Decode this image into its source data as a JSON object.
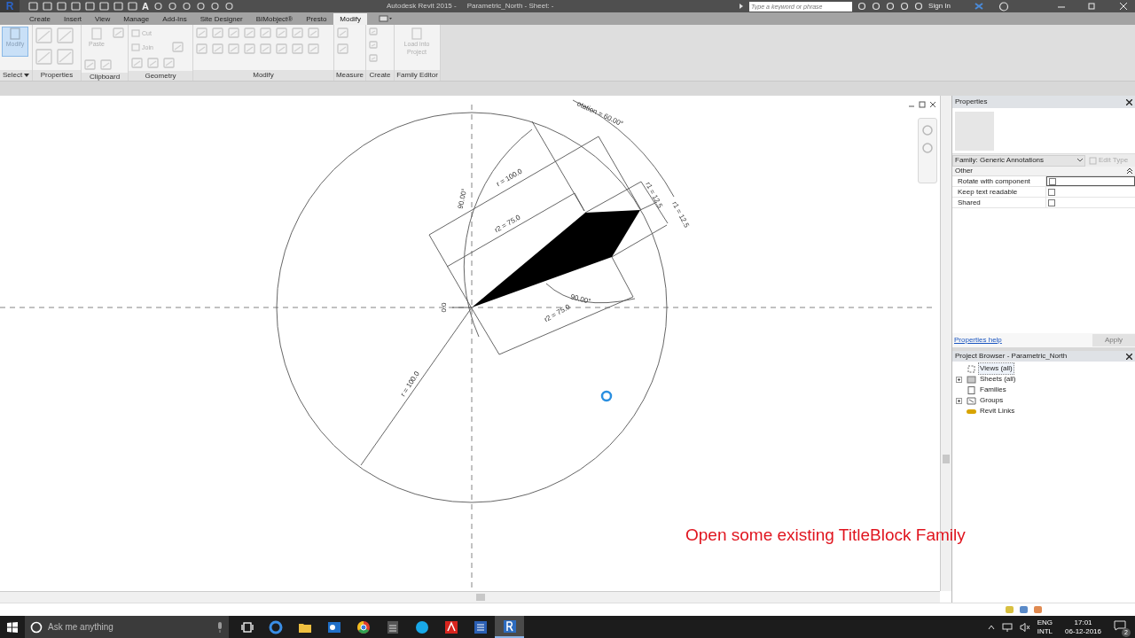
{
  "title_bar": {
    "logo": "R",
    "text_tool": "A",
    "app_title": "Autodesk Revit 2015 -",
    "document": "Parametric_North - Sheet: -",
    "search": {
      "placeholder": "Type a keyword or phrase"
    },
    "sign_in": "Sign In"
  },
  "tabs": [
    {
      "label": "Create",
      "selected": false
    },
    {
      "label": "Insert",
      "selected": false
    },
    {
      "label": "View",
      "selected": false
    },
    {
      "label": "Manage",
      "selected": false
    },
    {
      "label": "Add-Ins",
      "selected": false
    },
    {
      "label": "Site Designer",
      "selected": false
    },
    {
      "label": "BIMobject®",
      "selected": false
    },
    {
      "label": "Presto",
      "selected": false
    },
    {
      "label": "Modify",
      "selected": true
    }
  ],
  "ribbon": {
    "panels": [
      {
        "label": "Select",
        "dropdown": true,
        "buttons": [
          {
            "kind": "large",
            "label": "Modify",
            "selected": true,
            "disabled": false
          }
        ]
      },
      {
        "label": "Properties",
        "dropdown": false
      },
      {
        "label": "Clipboard",
        "dropdown": false,
        "buttons": [
          {
            "kind": "large",
            "label": "Paste",
            "selected": false,
            "disabled": true
          }
        ]
      },
      {
        "label": "Geometry",
        "dropdown": false,
        "buttons": [
          {
            "kind": "small",
            "label": "Cut",
            "selected": false,
            "disabled": true
          },
          {
            "kind": "small",
            "label": "Join",
            "selected": false,
            "disabled": true
          }
        ]
      },
      {
        "label": "Modify",
        "dropdown": false
      },
      {
        "label": "Measure",
        "dropdown": false
      },
      {
        "label": "Create",
        "dropdown": false
      },
      {
        "label": "Family Editor",
        "dropdown": false,
        "buttons": [
          {
            "kind": "large",
            "label": "Load into Project",
            "selected": false,
            "disabled": true
          }
        ]
      }
    ]
  },
  "canvas": {
    "dimension_labels": [
      "otation = 60.00°",
      "r = 100.0",
      "90.00°",
      "r2 = 75.0",
      "r1 = 12.5",
      "r1 = 12.5",
      "0.0",
      "90.00°",
      "r2 = 75.0",
      "r = 100.0"
    ],
    "note": "Open some existing TitleBlock Family"
  },
  "properties": {
    "title": "Properties",
    "type_selector": "Family: Generic Annotations",
    "edit_type": {
      "label": "Edit Type",
      "disabled": true
    },
    "group": "Other",
    "parameters": [
      {
        "name": "Rotate with component",
        "checked": false,
        "focused": true
      },
      {
        "name": "Keep text readable",
        "checked": false,
        "focused": false
      },
      {
        "name": "Shared",
        "checked": false,
        "focused": false
      }
    ],
    "help_link": "Properties help",
    "apply": {
      "label": "Apply",
      "disabled": true
    }
  },
  "project_browser": {
    "title": "Project Browser - Parametric_North",
    "items": [
      {
        "label": "Views (all)",
        "kind": "views",
        "expandable": false,
        "selected": true
      },
      {
        "label": "Sheets (all)",
        "kind": "sheets",
        "expandable": true,
        "selected": false
      },
      {
        "label": "Families",
        "kind": "families",
        "expandable": false,
        "selected": false
      },
      {
        "label": "Groups",
        "kind": "groups",
        "expandable": true,
        "selected": false
      },
      {
        "label": "Revit Links",
        "kind": "links",
        "expandable": false,
        "selected": false
      }
    ]
  },
  "taskbar": {
    "search": {
      "placeholder": "Ask me anything"
    },
    "apps": [
      {
        "kind": "edge",
        "active": false
      },
      {
        "kind": "explorer",
        "active": false
      },
      {
        "kind": "outlook",
        "active": false
      },
      {
        "kind": "chrome",
        "active": false
      },
      {
        "kind": "calculator",
        "active": false
      },
      {
        "kind": "skype",
        "active": false
      },
      {
        "kind": "acrobat",
        "active": false
      },
      {
        "kind": "word",
        "active": false
      },
      {
        "kind": "revit",
        "active": true
      }
    ],
    "tray": {
      "language": "ENG",
      "layout": "INTL",
      "time": "17:01",
      "date": "06-12-2016",
      "notifications": "2"
    }
  }
}
